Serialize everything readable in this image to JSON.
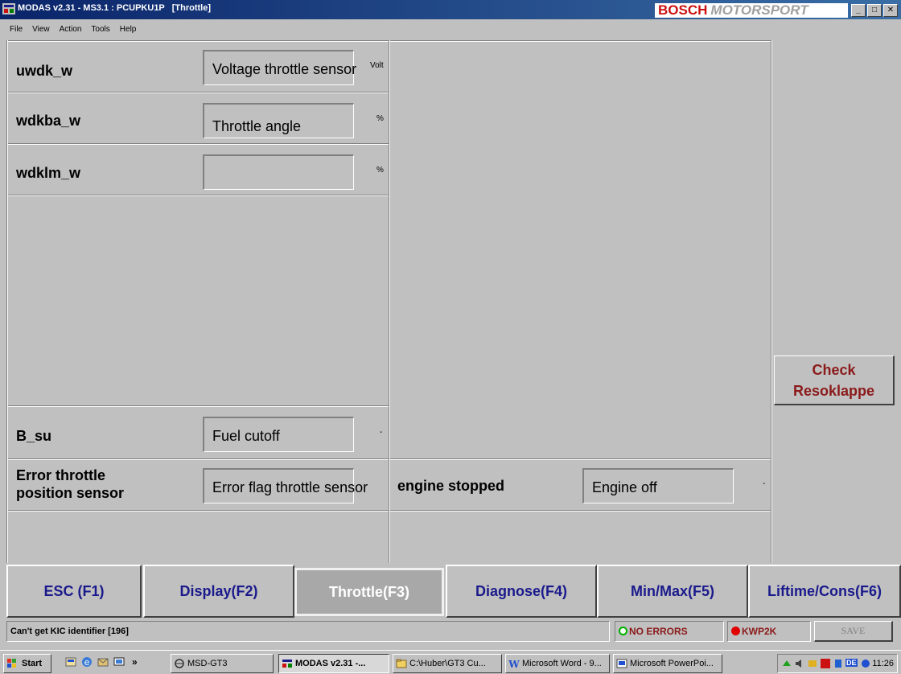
{
  "window": {
    "title": "MODAS v2.31 - MS3.1 : PCUPKU1P   [Throttle]",
    "brand_bosch": "BOSCH",
    "brand_motorsport": "MOTORSPORT",
    "minimize": "_",
    "maximize": "□",
    "close": "✕"
  },
  "menu": [
    "File",
    "View",
    "Action",
    "Tools",
    "Help"
  ],
  "rows": [
    {
      "label": "uwdk_w",
      "value": "Voltage throttle sensor",
      "unit": "Volt"
    },
    {
      "label": "wdkba_w",
      "value": "Throttle angle",
      "unit": "%"
    },
    {
      "label": "wdklm_w",
      "value": "",
      "unit": "%"
    },
    {
      "label": "B_su",
      "value": "Fuel cutoff",
      "unit": "-"
    },
    {
      "label": "Error throttle position sensor",
      "label_line1": "Error throttle",
      "label_line2": "position sensor",
      "value": "Error flag throttle sensor",
      "unit": ""
    }
  ],
  "right_row": {
    "label": "engine stopped",
    "value": "Engine off",
    "unit": "-"
  },
  "check_button": {
    "line1": "Check",
    "line2": "Resoklappe"
  },
  "function_keys": [
    {
      "label": "ESC (F1)",
      "active": false
    },
    {
      "label": "Display(F2)",
      "active": false
    },
    {
      "label": "Throttle(F3)",
      "active": true
    },
    {
      "label": "Diagnose(F4)",
      "active": false
    },
    {
      "label": "Min/Max(F5)",
      "active": false
    },
    {
      "label": "Liftime/Cons(F6)",
      "active": false
    }
  ],
  "status": {
    "message": "Can't get KIC identifier [196]",
    "errors": "NO ERRORS",
    "protocol": "KWP2K",
    "save": "SAVE"
  },
  "taskbar": {
    "start": "Start",
    "quick_chevron": "»",
    "items": [
      {
        "label": "MSD-GT3",
        "pressed": false
      },
      {
        "label": "MODAS v2.31 -...",
        "pressed": true
      },
      {
        "label": "C:\\Huber\\GT3 Cu...",
        "pressed": false
      },
      {
        "label": "Microsoft Word - 9...",
        "pressed": false
      },
      {
        "label": "Microsoft PowerPoi...",
        "pressed": false
      }
    ],
    "tray_lang": "DE",
    "clock": "11:26"
  }
}
